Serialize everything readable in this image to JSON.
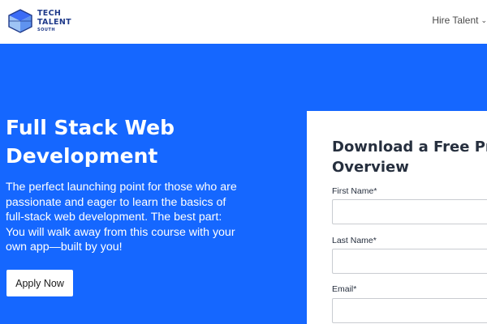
{
  "header": {
    "logo": {
      "line1": "TECH",
      "line2": "TALENT",
      "line3": "SOUTH"
    },
    "nav_hire_label": "Hire Talent"
  },
  "hero": {
    "title_line1": "Full Stack Web",
    "title_line2": "Development",
    "description": "The perfect launching point for those who are passionate and eager to learn the basics of full-stack web development. The best part: You will walk away from this course with your own app—built by you!",
    "apply_label": "Apply Now"
  },
  "form": {
    "title_line1": "Download a Free Pro",
    "title_line2": "Overview",
    "fields": [
      {
        "label": "First Name*",
        "value": ""
      },
      {
        "label": "Last Name*",
        "value": ""
      },
      {
        "label": "Email*",
        "value": ""
      }
    ]
  },
  "colors": {
    "hero_blue": "#1567ff",
    "logo_navy": "#1f3a8a",
    "heading_dark": "#262f3e"
  }
}
